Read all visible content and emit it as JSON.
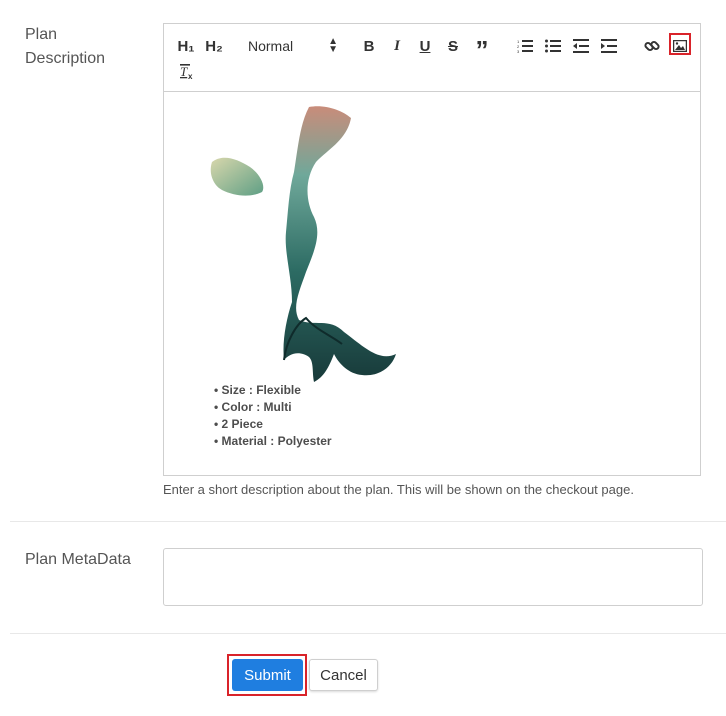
{
  "plan_description": {
    "label_line1": "Plan",
    "label_line2": "Description",
    "toolbar": {
      "h1": "H₁",
      "h2": "H₂",
      "format_select": "Normal",
      "bold": "B",
      "italic": "I",
      "underline": "U",
      "strike": "S",
      "quote": "”",
      "icons": [
        "ordered-list-icon",
        "bullet-list-icon",
        "outdent-icon",
        "indent-icon",
        "link-icon",
        "image-icon",
        "clear-format-icon"
      ]
    },
    "bullets": [
      "Size : Flexible",
      "Color : Multi",
      "2 Piece",
      "Material : Polyester"
    ],
    "help_text": "Enter a short description about the plan. This will be shown on the checkout page."
  },
  "plan_metadata": {
    "label": "Plan MetaData",
    "value": ""
  },
  "actions": {
    "submit_label": "Submit",
    "cancel_label": "Cancel"
  },
  "colors": {
    "primary": "#1f7ee0",
    "highlight": "#d9232a",
    "border": "#cfcfcf"
  }
}
